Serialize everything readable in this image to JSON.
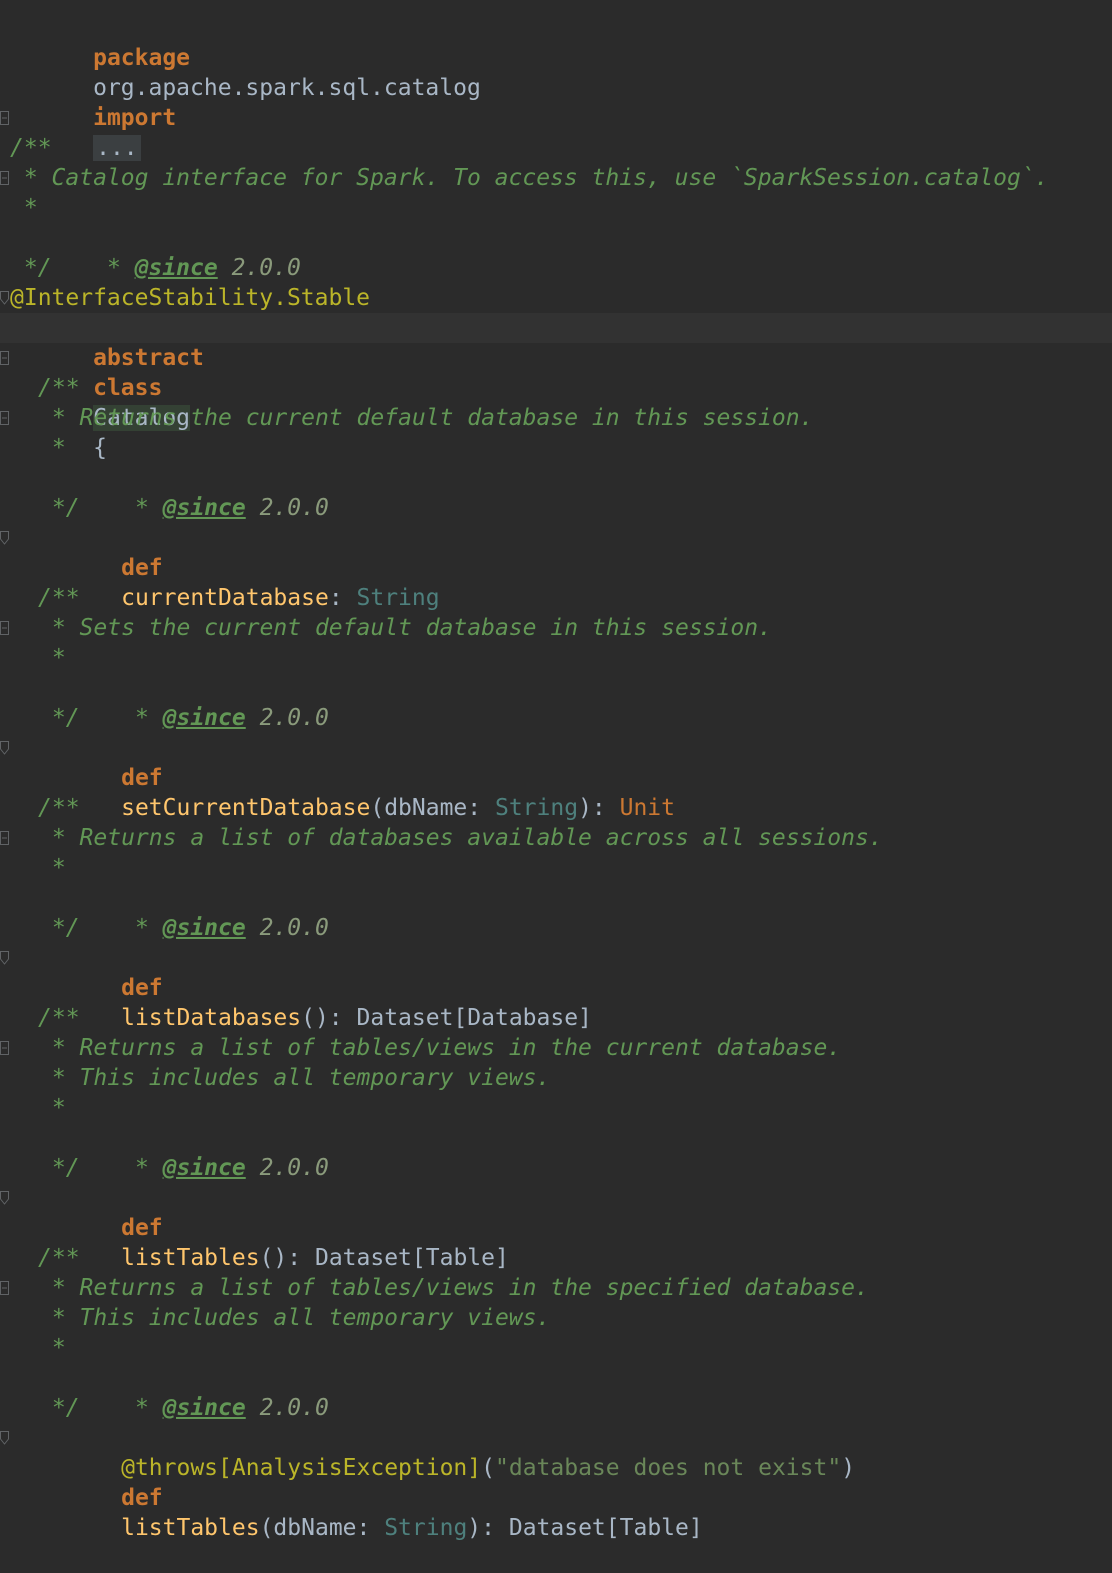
{
  "editor": {
    "package": {
      "keyword": "package",
      "name": "org.apache.spark.sql.catalog"
    },
    "imports": {
      "keyword": "import",
      "collapsed": "..."
    },
    "class_doc": {
      "open": "/**",
      "line1": " * Catalog interface for Spark. To access this, use `SparkSession.catalog`.",
      "blank": " *",
      "since_prefix": " * ",
      "since_tag": "@since",
      "since_value": " 2.0.0",
      "close": " */"
    },
    "class_decl": {
      "annotation": "@InterfaceStability.Stable",
      "kw1": "abstract",
      "kw2": "class",
      "name": "Catalog",
      "brace": "{"
    },
    "methods": [
      {
        "doc_open": "/**",
        "doc_lines": [
          " * Returns the current default database in this session."
        ],
        "doc_blank": " *",
        "since_prefix": " * ",
        "since_tag": "@since",
        "since_value": " 2.0.0",
        "doc_close": " */",
        "def_kw": "def",
        "name": "currentDatabase",
        "params": "",
        "sig_rest": ": ",
        "return": "String"
      },
      {
        "doc_open": "/**",
        "doc_lines": [
          " * Sets the current default database in this session."
        ],
        "doc_blank": " *",
        "since_prefix": " * ",
        "since_tag": "@since",
        "since_value": " 2.0.0",
        "doc_close": " */",
        "def_kw": "def",
        "name": "setCurrentDatabase",
        "param_open": "(dbName: ",
        "param_type": "String",
        "param_close": "): ",
        "return": "Unit"
      },
      {
        "doc_open": "/**",
        "doc_lines": [
          " * Returns a list of databases available across all sessions."
        ],
        "doc_blank": " *",
        "since_prefix": " * ",
        "since_tag": "@since",
        "since_value": " 2.0.0",
        "doc_close": " */",
        "def_kw": "def",
        "name": "listDatabases",
        "sig_rest": "(): ",
        "return": "Dataset[Database]"
      },
      {
        "doc_open": "/**",
        "doc_lines": [
          " * Returns a list of tables/views in the current database.",
          " * This includes all temporary views."
        ],
        "doc_blank": " *",
        "since_prefix": " * ",
        "since_tag": "@since",
        "since_value": " 2.0.0",
        "doc_close": " */",
        "def_kw": "def",
        "name": "listTables",
        "sig_rest": "(): ",
        "return": "Dataset[Table]"
      },
      {
        "doc_open": "/**",
        "doc_lines": [
          " * Returns a list of tables/views in the specified database.",
          " * This includes all temporary views."
        ],
        "doc_blank": " *",
        "since_prefix": " * ",
        "since_tag": "@since",
        "since_value": " 2.0.0",
        "doc_close": " */",
        "throws_ann": "@throws",
        "throws_type": "[AnalysisException]",
        "throws_open": "(",
        "throws_msg": "\"database does not exist\"",
        "throws_close": ")",
        "def_kw": "def",
        "name": "listTables",
        "param_open": "(dbName: ",
        "param_type": "String",
        "param_close": "): ",
        "return": "Dataset[Table]"
      }
    ]
  },
  "colors": {
    "background": "#2b2b2b",
    "caret_row": "#323232",
    "keyword": "#cc7832",
    "function": "#ffc66d",
    "annotation": "#bbb529",
    "doc_comment": "#629755",
    "builtin_type": "#4e807d",
    "text": "#a9b7c6"
  },
  "icons": [
    "fold-open-icon",
    "fold-close-icon"
  ]
}
